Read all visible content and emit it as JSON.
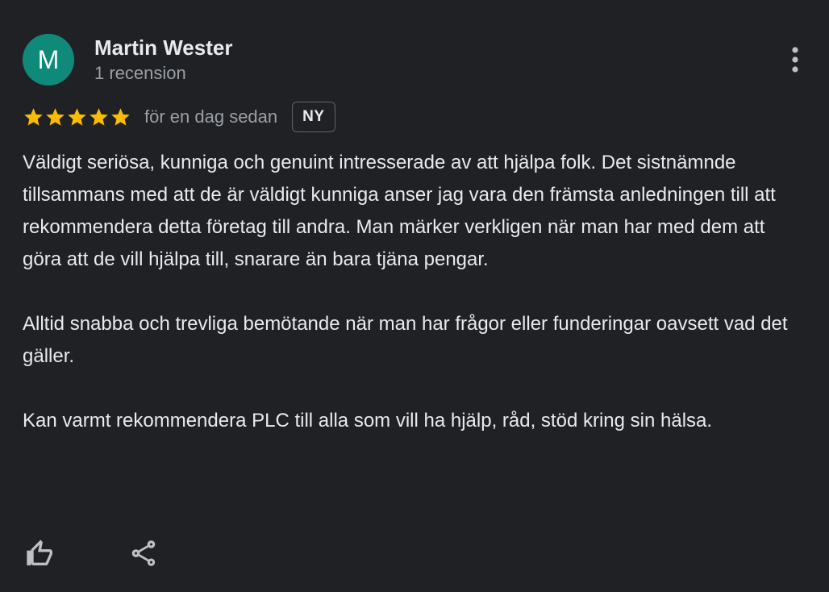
{
  "reviewer": {
    "avatar_letter": "M",
    "avatar_color": "#0f8a7a",
    "name": "Martin Wester",
    "review_count": "1 recension"
  },
  "rating": {
    "stars": 5,
    "max_stars": 5,
    "star_color": "#fbbc04",
    "time": "för en dag sedan",
    "badge": "NY"
  },
  "review": {
    "paragraphs": [
      "Väldigt seriösa, kunniga och genuint intresserade av att hjälpa folk. Det sistnämnde tillsammans med att de är väldigt kunniga anser jag vara den främsta anledningen till att rekommendera detta företag till andra. Man märker verkligen när man har med dem att göra att de vill hjälpa till, snarare än bara tjäna pengar.",
      "Alltid snabba och trevliga bemötande när man har frågor eller funderingar oavsett vad det gäller.",
      "Kan varmt rekommendera PLC till alla som vill ha hjälp, råd, stöd kring sin hälsa."
    ]
  },
  "icons": {
    "more": "more-vert-icon",
    "like": "thumbs-up-icon",
    "share": "share-icon"
  }
}
